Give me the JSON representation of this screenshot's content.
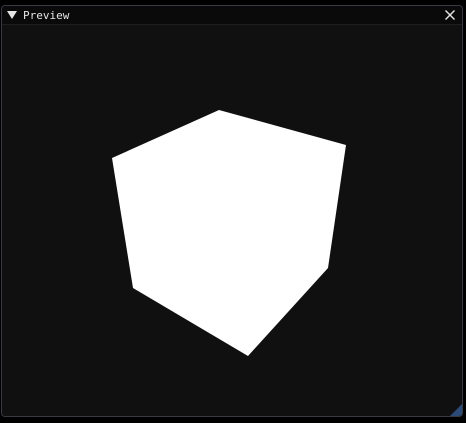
{
  "window": {
    "title": "Preview"
  },
  "icons": {
    "collapse": "triangle-down-icon",
    "close": "close-icon",
    "resize": "resize-grip-icon"
  },
  "colors": {
    "window_bg": "#0f0f0f",
    "title_bg": "#0a0a0a",
    "title_text": "#e6e6e6",
    "viewport_bg": "#101010",
    "cube": "#ffffff",
    "resize_grip": "#2b4a78"
  }
}
